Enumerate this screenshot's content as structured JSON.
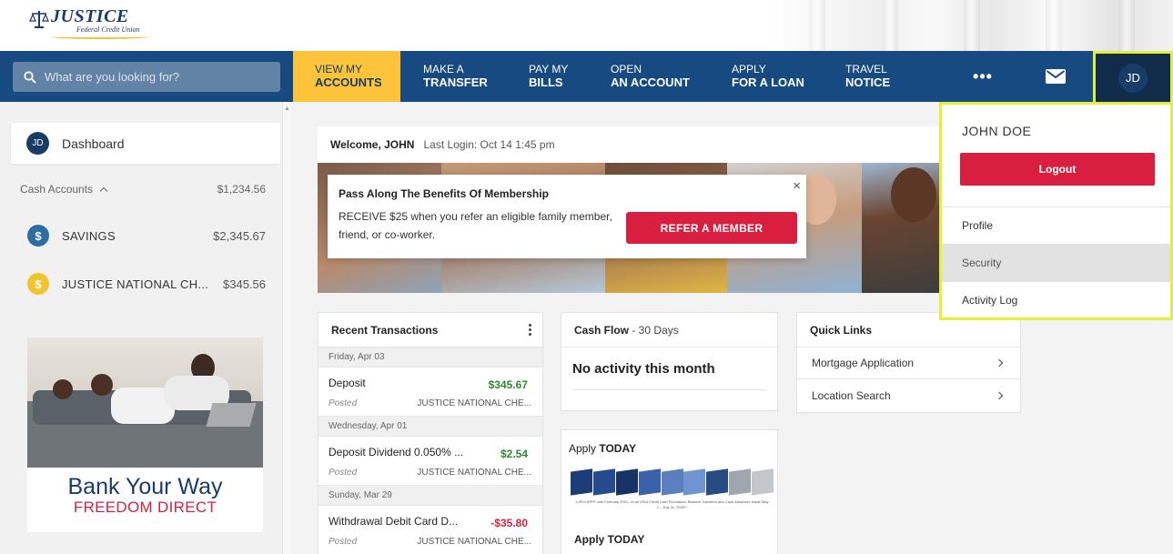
{
  "brand": {
    "name": "JUSTICE",
    "sub": "Federal Credit Union"
  },
  "search": {
    "placeholder": "What are you looking for?"
  },
  "nav": [
    {
      "l1": "VIEW MY",
      "l2": "ACCOUNTS"
    },
    {
      "l1": "MAKE A",
      "l2": "TRANSFER"
    },
    {
      "l1": "PAY MY",
      "l2": "BILLS"
    },
    {
      "l1": "OPEN",
      "l2": "AN ACCOUNT"
    },
    {
      "l1": "APPLY",
      "l2": "FOR A LOAN"
    },
    {
      "l1": "TRAVEL",
      "l2": "NOTICE"
    }
  ],
  "nav_more": "•••",
  "user": {
    "initials": "JD",
    "name": "JOHN DOE"
  },
  "sidebar": {
    "dashboard": "Dashboard",
    "cash_label": "Cash Accounts",
    "cash_total": "$1,234.56",
    "accounts": [
      {
        "icon": "$",
        "name": "SAVINGS",
        "amount": "$2,345.67",
        "color": "#2e6ca4"
      },
      {
        "icon": "$",
        "name": "JUSTICE NATIONAL CH...",
        "amount": "$345.56",
        "color": "#f4c430"
      }
    ],
    "promo": {
      "line1": "Bank Your Way",
      "line2": "FREEDOM DIRECT"
    }
  },
  "welcome": {
    "greeting": "Welcome, JOHN",
    "last_login": "Last Login: Oct 14 1:45 pm"
  },
  "referral": {
    "title": "Pass Along The Benefits Of Membership",
    "body": "RECEIVE $25 when you refer an eligible family member, friend, or co-worker.",
    "cta": "REFER A MEMBER",
    "close": "×"
  },
  "transactions": {
    "title": "Recent Transactions",
    "groups": [
      {
        "date": "Friday, Apr 03",
        "items": [
          {
            "desc": "Deposit",
            "amount": "$345.67",
            "status": "Posted",
            "account": "JUSTICE NATIONAL CHE..."
          }
        ]
      },
      {
        "date": "Wednesday, Apr 01",
        "items": [
          {
            "desc": "Deposit Dividend 0.050% ...",
            "amount": "$2.54",
            "status": "Posted",
            "account": "JUSTICE NATIONAL CHE..."
          }
        ]
      },
      {
        "date": "Sunday, Mar 29",
        "items": [
          {
            "desc": "Withdrawal Debit Card D...",
            "amount": "-$35.80",
            "status": "Posted",
            "account": "JUSTICE NATIONAL CHE..."
          }
        ]
      }
    ]
  },
  "cashflow": {
    "title": "Cash Flow",
    "range": " - 30 Days",
    "empty": "No activity this month"
  },
  "apply": {
    "title_a": "Apply ",
    "title_b": "TODAY",
    "footer": "Apply TODAY",
    "promo_text": "4.99% APR* until February 2021, on all VISA Credit Card Purchases, Balance Transfers and Cash Advances made May 1 – July 31, 2020**"
  },
  "quick_links": {
    "title": "Quick Links",
    "items": [
      "Mortgage Application",
      "Location Search"
    ]
  },
  "dropdown": {
    "logout": "Logout",
    "items": [
      "Profile",
      "Security",
      "Activity Log"
    ]
  },
  "colors": {
    "navy": "#164a80",
    "gold": "#fcc33b",
    "red": "#d91f3f",
    "highlight": "#e3ef3a"
  }
}
